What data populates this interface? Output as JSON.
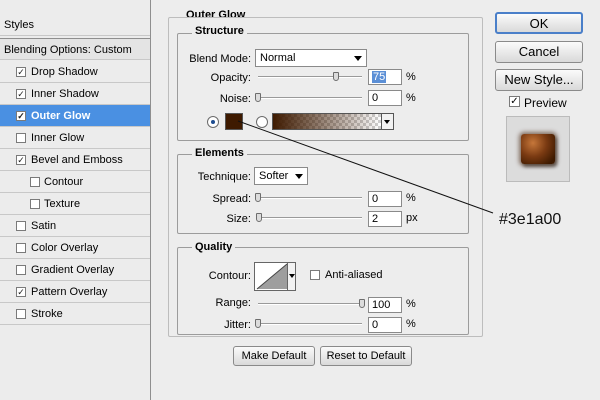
{
  "sidebar": {
    "title": "Styles",
    "blending": "Blending Options: Custom",
    "items": [
      {
        "label": "Drop Shadow",
        "checked": true
      },
      {
        "label": "Inner Shadow",
        "checked": true
      },
      {
        "label": "Outer Glow",
        "checked": true,
        "selected": true
      },
      {
        "label": "Inner Glow",
        "checked": false
      },
      {
        "label": "Bevel and Emboss",
        "checked": true
      },
      {
        "label": "Contour",
        "checked": false,
        "sub": true
      },
      {
        "label": "Texture",
        "checked": false,
        "sub": true
      },
      {
        "label": "Satin",
        "checked": false
      },
      {
        "label": "Color Overlay",
        "checked": false
      },
      {
        "label": "Gradient Overlay",
        "checked": false
      },
      {
        "label": "Pattern Overlay",
        "checked": true
      },
      {
        "label": "Stroke",
        "checked": false
      }
    ]
  },
  "panel": {
    "title": "Outer Glow",
    "structure": {
      "title": "Structure",
      "blend_mode_label": "Blend Mode:",
      "blend_mode_value": "Normal",
      "opacity_label": "Opacity:",
      "opacity_value": "75",
      "opacity_fraction": 0.75,
      "opacity_unit": "%",
      "noise_label": "Noise:",
      "noise_value": "0",
      "noise_fraction": 0,
      "noise_unit": "%",
      "glow_color": "#3e1a00"
    },
    "elements": {
      "title": "Elements",
      "technique_label": "Technique:",
      "technique_value": "Softer",
      "spread_label": "Spread:",
      "spread_value": "0",
      "spread_fraction": 0,
      "spread_unit": "%",
      "size_label": "Size:",
      "size_value": "2",
      "size_fraction": 0.01,
      "size_unit": "px"
    },
    "quality": {
      "title": "Quality",
      "contour_label": "Contour:",
      "anti_aliased_label": "Anti-aliased",
      "anti_aliased": false,
      "range_label": "Range:",
      "range_value": "100",
      "range_fraction": 1.0,
      "range_unit": "%",
      "jitter_label": "Jitter:",
      "jitter_value": "0",
      "jitter_fraction": 0,
      "jitter_unit": "%"
    },
    "make_default": "Make Default",
    "reset_default": "Reset to Default"
  },
  "buttons": {
    "ok": "OK",
    "cancel": "Cancel",
    "new_style": "New Style...",
    "preview_label": "Preview",
    "preview_checked": true
  },
  "annotation": "#3e1a00",
  "colors": {
    "selection": "#4a90e2",
    "glow": "#3e1a00"
  }
}
